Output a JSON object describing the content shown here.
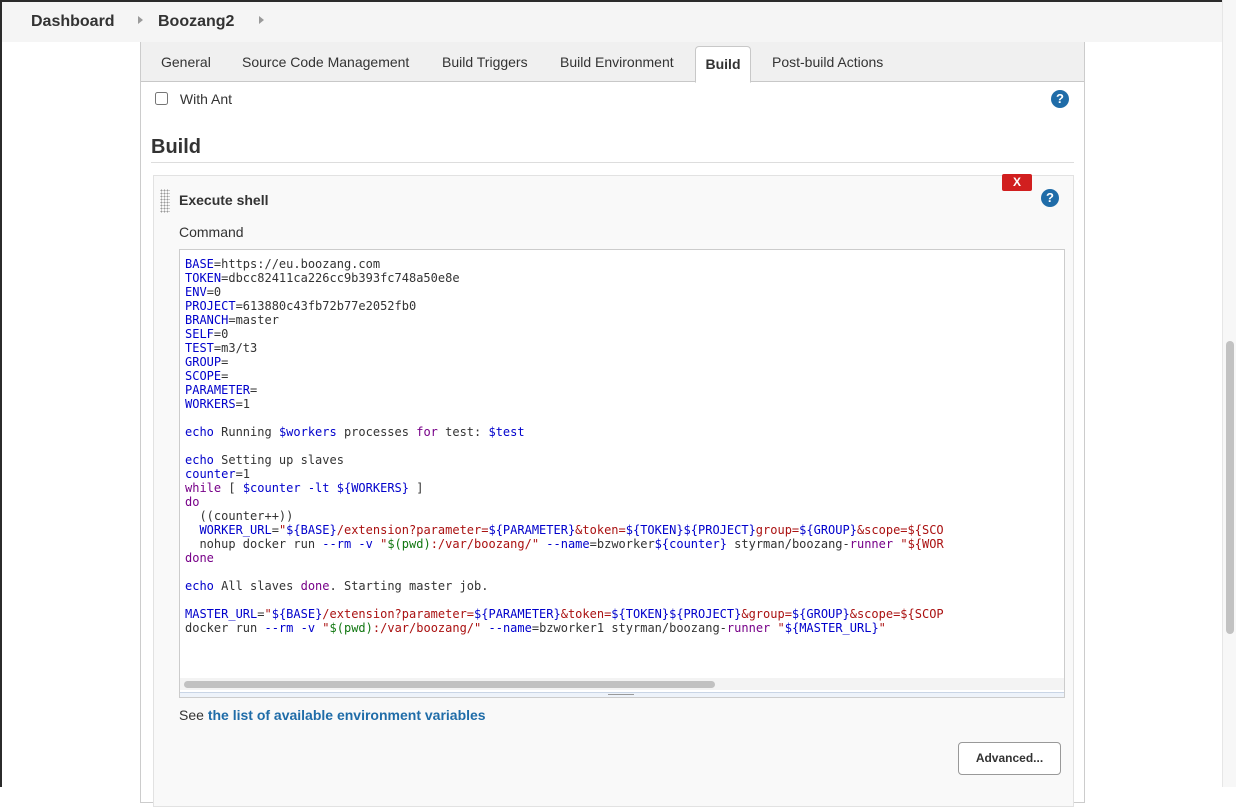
{
  "breadcrumbs": [
    {
      "label": "Dashboard"
    },
    {
      "label": "Boozang2"
    }
  ],
  "tabs": [
    {
      "label": "General"
    },
    {
      "label": "Source Code Management"
    },
    {
      "label": "Build Triggers"
    },
    {
      "label": "Build Environment"
    },
    {
      "label": "Build",
      "active": true
    },
    {
      "label": "Post-build Actions"
    }
  ],
  "with_ant": {
    "label": "With Ant",
    "checked": false
  },
  "help_label": "?",
  "build_section": {
    "title": "Build",
    "step": {
      "title": "Execute shell",
      "delete_label": "X",
      "command_label": "Command",
      "command_lines": [
        "BASE=https://eu.boozang.com",
        "TOKEN=dbcc82411ca226cc9b393fc748a50e8e",
        "ENV=0",
        "PROJECT=613880c43fb72b77e2052fb0",
        "BRANCH=master",
        "SELF=0",
        "TEST=m3/t3",
        "GROUP=",
        "SCOPE=",
        "PARAMETER=",
        "WORKERS=1",
        "",
        "echo Running $workers processes for test: $test",
        "",
        "echo Setting up slaves",
        "counter=1",
        "while [ $counter -lt ${WORKERS} ]",
        "do",
        "  ((counter++))",
        "  WORKER_URL=\"${BASE}/extension?parameter=${PARAMETER}&token=${TOKEN}${PROJECT}group=${GROUP}&scope=${SCO",
        "  nohup docker run --rm -v \"$(pwd):/var/boozang/\" --name=bzworker${counter} styrman/boozang-runner \"${WOR",
        "done",
        "",
        "echo All slaves done. Starting master job.",
        "",
        "MASTER_URL=\"${BASE}/extension?parameter=${PARAMETER}&token=${TOKEN}${PROJECT}&group=${GROUP}&scope=${SCOP",
        "docker run --rm -v \"$(pwd):/var/boozang/\" --name=bzworker1 styrman/boozang-runner \"${MASTER_URL}\""
      ],
      "env_note_prefix": "See ",
      "env_note_link": "the list of available environment variables",
      "advanced_label": "Advanced..."
    }
  },
  "colors": {
    "help_blue": "#1f6ca8",
    "delete_red": "#d11f1f",
    "code_variable": "#0000cc",
    "code_string": "#aa1111",
    "code_subshell": "#117711",
    "code_keyword": "#770088"
  }
}
